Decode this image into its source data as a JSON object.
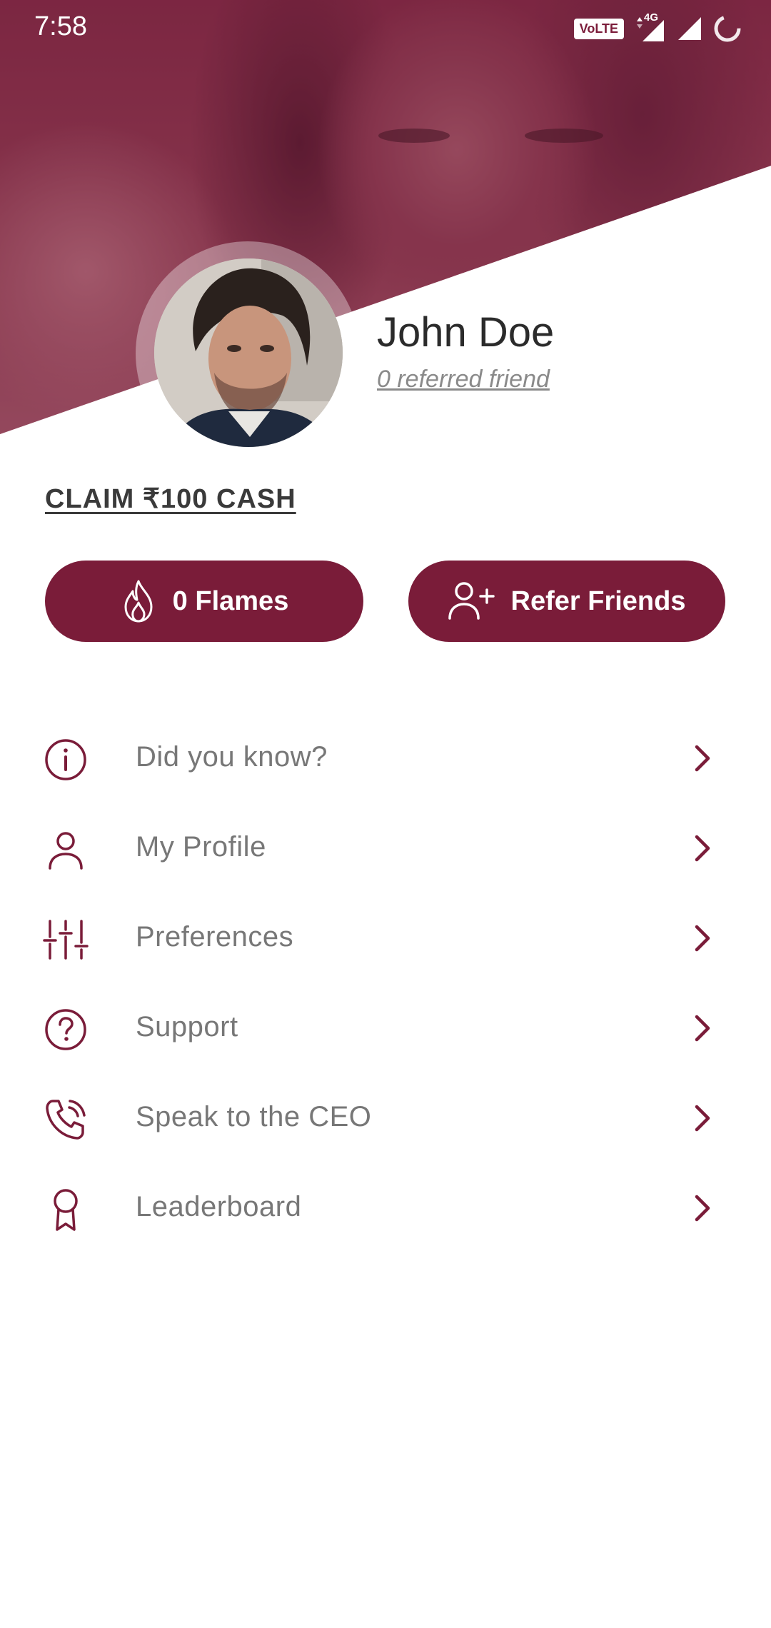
{
  "status_bar": {
    "time": "7:58",
    "volte": "VoLTE",
    "network": "4G",
    "icons": [
      "volte-icon",
      "signal-4g-icon",
      "signal-icon",
      "loading-icon"
    ]
  },
  "profile": {
    "name": "John Doe",
    "referred": "0 referred friend"
  },
  "claim": {
    "label": "CLAIM ₹100 CASH"
  },
  "buttons": {
    "flames_label": "0 Flames",
    "refer_label": "Refer Friends"
  },
  "menu": {
    "items": [
      {
        "label": "Did you know?",
        "icon": "info-icon"
      },
      {
        "label": "My Profile",
        "icon": "user-icon"
      },
      {
        "label": "Preferences",
        "icon": "sliders-icon"
      },
      {
        "label": "Support",
        "icon": "help-circle-icon"
      },
      {
        "label": "Speak to the CEO",
        "icon": "phone-call-icon"
      },
      {
        "label": "Leaderboard",
        "icon": "award-icon"
      }
    ]
  },
  "colors": {
    "brand": "#7a1c39",
    "label_gray": "#777777",
    "name_text": "#2b2b2b"
  }
}
